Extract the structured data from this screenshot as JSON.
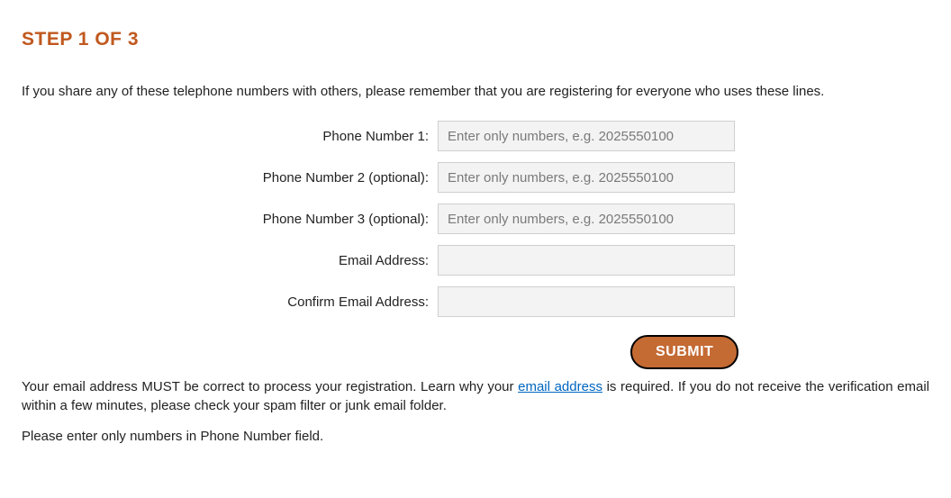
{
  "heading": "STEP 1 OF 3",
  "intro": "If you share any of these telephone numbers with others, please remember that you are registering for everyone who uses these lines.",
  "form": {
    "phone1": {
      "label": "Phone Number 1:",
      "placeholder": "Enter only numbers, e.g. 2025550100",
      "value": ""
    },
    "phone2": {
      "label": "Phone Number 2 (optional):",
      "placeholder": "Enter only numbers, e.g. 2025550100",
      "value": ""
    },
    "phone3": {
      "label": "Phone Number 3 (optional):",
      "placeholder": "Enter only numbers, e.g. 2025550100",
      "value": ""
    },
    "email": {
      "label": "Email Address:",
      "value": ""
    },
    "confirm_email": {
      "label": "Confirm Email Address:",
      "value": ""
    },
    "submit_label": "SUBMIT"
  },
  "notice": {
    "before_link": "Your email address MUST be correct to process your registration. Learn why your ",
    "link_text": "email address",
    "after_link": " is required. If you do not receive the verification email within a few minutes, please check your spam filter or junk email folder."
  },
  "helper": "Please enter only numbers in Phone Number field."
}
